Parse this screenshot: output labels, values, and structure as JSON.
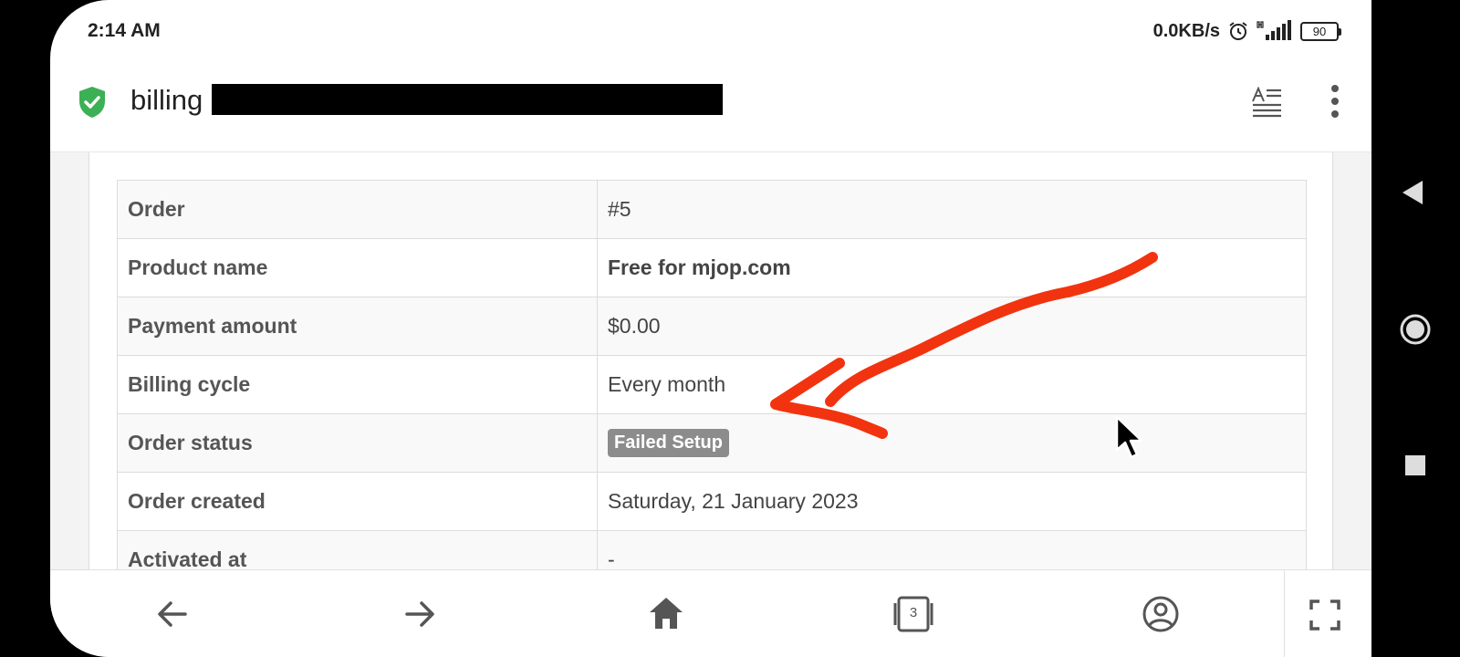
{
  "status_bar": {
    "time": "2:14 AM",
    "net_speed": "0.0KB/s",
    "battery": "90",
    "icons": [
      "alarm-icon",
      "signal-icon",
      "battery-icon"
    ]
  },
  "browser": {
    "url_prefix": "billing",
    "secure_icon": "shield-check-icon",
    "tab_count": "3"
  },
  "order_details": {
    "rows": [
      {
        "label": "Order",
        "value": "#5"
      },
      {
        "label": "Product name",
        "value": "Free for mjop.com"
      },
      {
        "label": "Payment amount",
        "value": "$0.00"
      },
      {
        "label": "Billing cycle",
        "value": "Every month"
      },
      {
        "label": "Order status",
        "value": "Failed Setup"
      },
      {
        "label": "Order created",
        "value": "Saturday, 21 January 2023"
      },
      {
        "label": "Activated at",
        "value": "-"
      }
    ]
  },
  "colors": {
    "secure_green": "#3cb054",
    "badge_gray": "#8c8c8c",
    "annotation_red": "#f2330f"
  }
}
